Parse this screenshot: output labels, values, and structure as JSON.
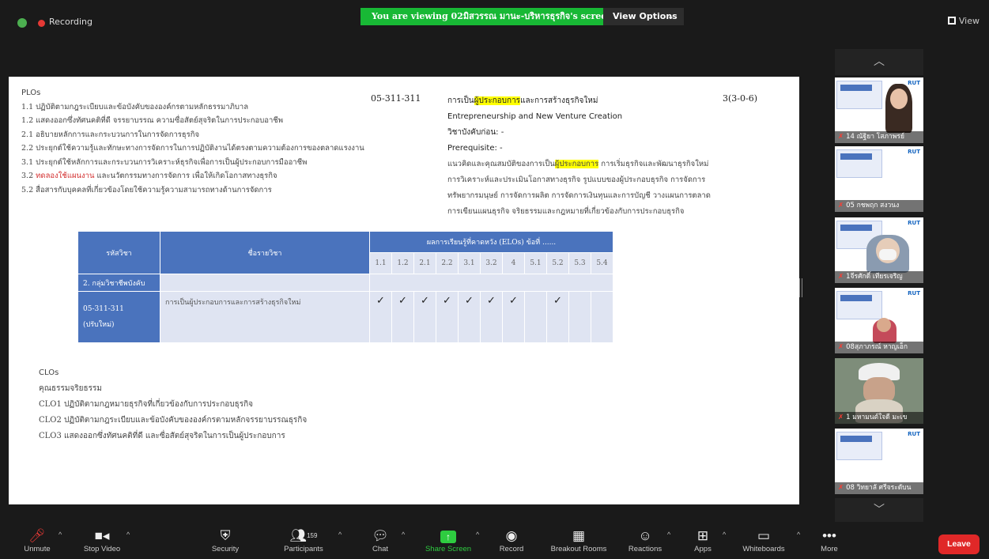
{
  "topbar": {
    "recording_label": "Recording",
    "viewing_banner": "You are viewing 02มิสวรรณ มานะ-บริหารธุรกิจ's screen",
    "view_options_label": "View Options",
    "view_label": "View"
  },
  "slide": {
    "plos_title": "PLOs",
    "plos": [
      "1.1 ปฏิบัติตามกฎระเบียบและข้อบังคับขององค์กรตามหลักธรรมาภิบาล",
      "1.2 แสดงออกซึ่งทัศนคติที่ดี จรรยาบรรณ ความซื่อสัตย์สุจริตในการประกอบอาชีพ",
      "2.1 อธิบายหลักการและกระบวนการในการจัดการธุรกิจ",
      "2.2 ประยุกต์ใช้ความรู้และทักษะทางการจัดการในการปฏิบัติงานได้ตรงตามความต้องการของตลาดแรงงาน",
      "3.1 ประยุกต์ใช้หลักการและกระบวนการวิเคราะห์ธุรกิจเพื่อการเป็นผู้ประกอบการมืออาชีพ",
      "3.2 ทดลองใช้แผนงาน และนวัตกรรมทางการจัดการ เพื่อให้เกิดโอกาสทางธุรกิจ",
      "5.2 สื่อสารกับบุคคลที่เกี่ยวข้องโดยใช้ความรู้ความสามารถทางด้านการจัดการ"
    ],
    "plo_32_prefix": "3.2 ",
    "plo_32_red": "ทดลองใช้แผนงาน",
    "plo_32_rest": " และนวัตกรรมทางการจัดการ เพื่อให้เกิดโอกาสทางธุรกิจ",
    "course_code": "05-311-311",
    "course_th_pre": "การเป็น",
    "course_th_hl": "ผู้ประกอบการ",
    "course_th_post": "และการสร้างธุรกิจใหม่",
    "course_en": "Entrepreneurship and New Venture Creation",
    "credits": "3(3-0-6)",
    "prereq_th": "วิชาบังคับก่อน:  -",
    "prereq_en": "Prerequisite:  -",
    "desc_pre": "แนวคิดและคุณสมบัติของการเป็น",
    "desc_hl": "ผู้ประกอบการ",
    "desc_post": "  การเริ่มธุรกิจและพัฒนาธุรกิจใหม่",
    "desc_lines": [
      "การวิเคราะห์และประเมินโอกาสทางธุรกิจ  รูปแบบของผู้ประกอบธุรกิจ  การจัดการ",
      "ทรัพยากรมนุษย์  การจัดการผลิต  การจัดการเงินทุนและการบัญชี  วางแผนการตลาด",
      "การเขียนแผนธุรกิจ  จริยธรรมและกฎหมายที่เกี่ยวข้องกับการประกอบธุรกิจ"
    ],
    "table": {
      "col_code": "รหัสวิชา",
      "col_name": "ชื่อรายวิชา",
      "col_elos": "ผลการเรียนรู้ที่คาดหวัง (ELOs) ข้อที่ ......",
      "elo_numbers": [
        "1.1",
        "1.2",
        "2.1",
        "2.2",
        "3.1",
        "3.2",
        "4",
        "5.1",
        "5.2",
        "5.3",
        "5.4"
      ],
      "group_label": "2. กลุ่มวิชาชีพบังคับ",
      "row_code": "05-311-311",
      "row_code_note": "(ปรับใหม่)",
      "row_name": "การเป็นผู้ประกอบการและการสร้างธุรกิจใหม่",
      "checks": [
        "✓",
        "✓",
        "✓",
        "✓",
        "✓",
        "✓",
        "✓",
        "",
        "✓",
        "",
        ""
      ]
    },
    "clos_title": "CLOs",
    "clos_sub": "คุณธรรมจริยธรรม",
    "clos": [
      "CLO1 ปฏิบัติตามกฎหมายธุรกิจที่เกี่ยวข้องกับการประกอบธุรกิจ",
      "CLO2 ปฏิบัติตามกฎระเบียบและข้อบังคับขององค์กรตามหลักจรรยาบรรณธุรกิจ",
      "CLO3 แสดงออกซึ่งทัศนคติที่ดี และซื่อสัตย์สุจริตในการเป็นผู้ประกอบการ"
    ]
  },
  "participants": [
    {
      "name": "14 ณัฐิยา โสภาพรย์",
      "rut": "RUT"
    },
    {
      "name": "05 กชพฤก สงวนง",
      "rut": "RUT"
    },
    {
      "name": "1จีรศักดิ์ เทียรเจริญ",
      "rut": "RUT"
    },
    {
      "name": "08สุภาภรณ์ หาญเอ็ก",
      "rut": "RUT"
    },
    {
      "name": "1 มหามนต์ใจดี มะเข",
      "rut": ""
    },
    {
      "name": "08 วิทยาลั ศรีจระดับน",
      "rut": "RUT"
    }
  ],
  "toolbar": {
    "unmute": "Unmute",
    "stop_video": "Stop Video",
    "security": "Security",
    "participants": "Participants",
    "participant_count": "159",
    "chat": "Chat",
    "share_screen": "Share Screen",
    "record": "Record",
    "breakout_rooms": "Breakout Rooms",
    "reactions": "Reactions",
    "apps": "Apps",
    "whiteboards": "Whiteboards",
    "more": "More",
    "leave": "Leave"
  },
  "colors": {
    "banner_green": "#18b835",
    "table_blue": "#4a73bd",
    "leave_red": "#e02828",
    "highlight": "#ffff00"
  },
  "icons": [
    "shield-icon",
    "record-dot-icon",
    "grid-view-icon",
    "mic-muted-icon",
    "video-icon",
    "security-shield-icon",
    "participants-icon",
    "chat-icon",
    "share-screen-icon",
    "record-icon",
    "breakout-icon",
    "reactions-icon",
    "apps-icon",
    "whiteboard-icon",
    "more-icon"
  ]
}
